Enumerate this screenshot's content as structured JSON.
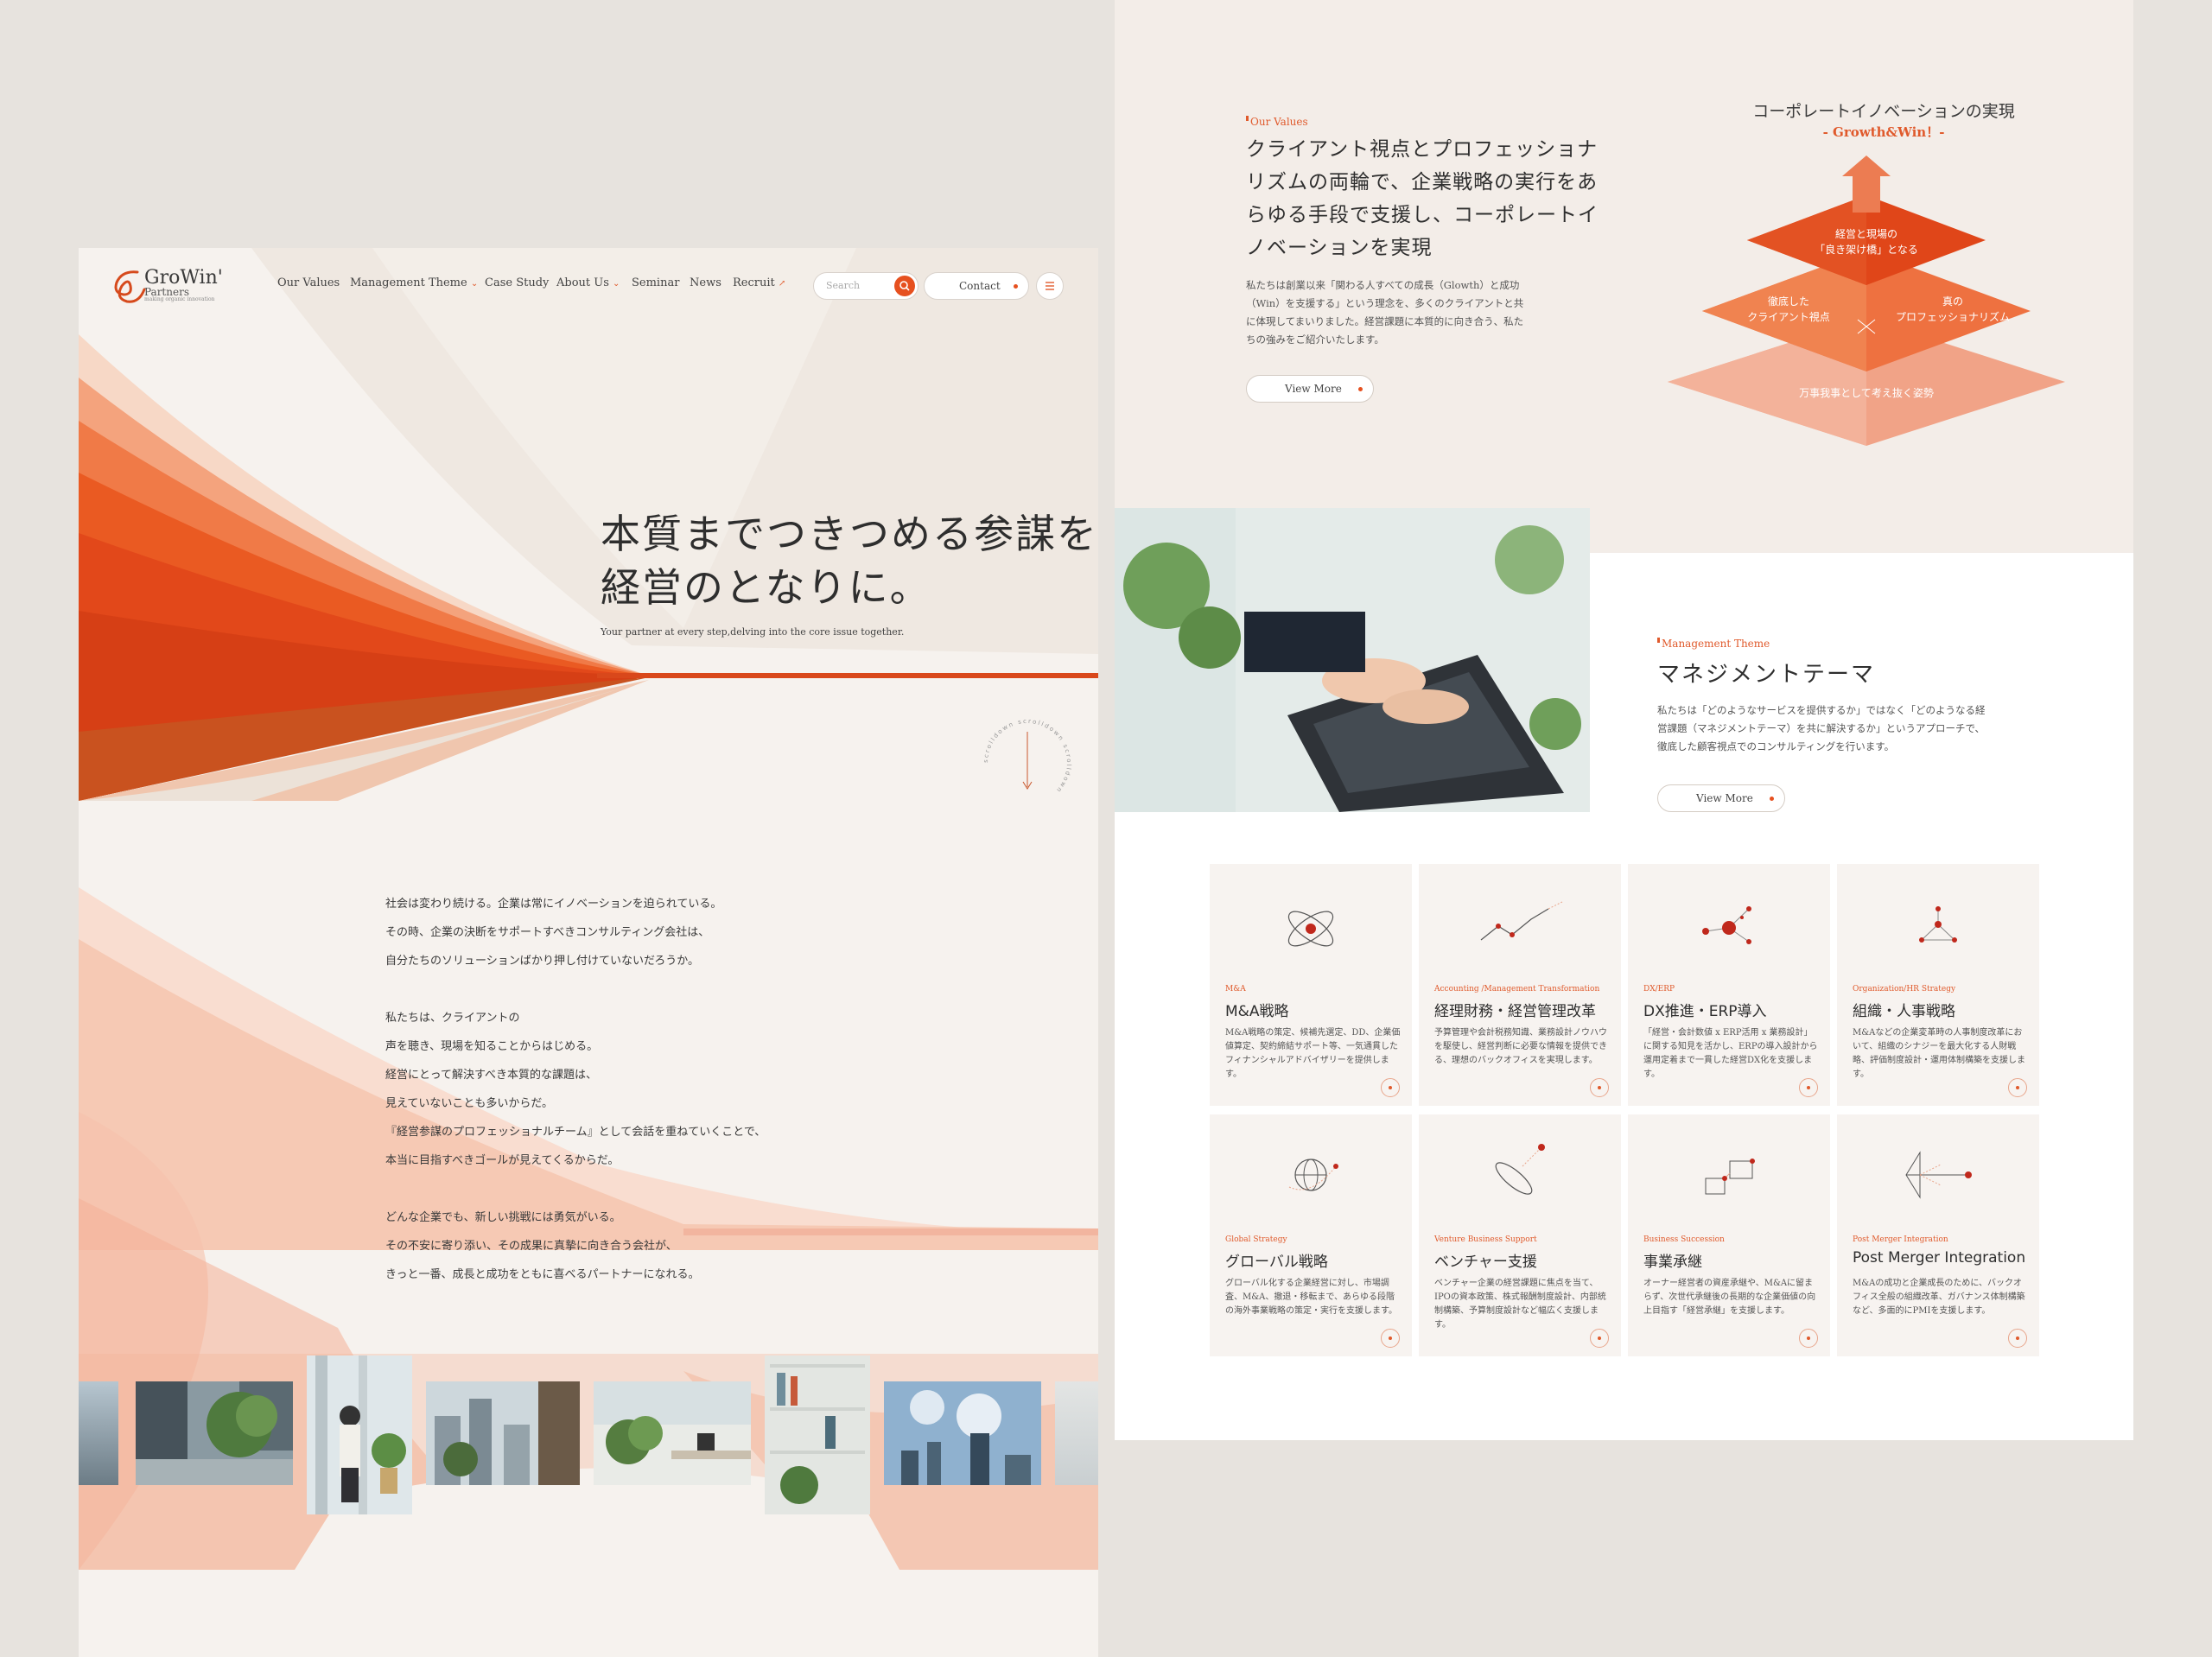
{
  "left_page": {
    "logo": {
      "name": "GroWin'",
      "sub": "Partners",
      "tagline": "making organic innovation"
    },
    "nav": {
      "items": [
        "Our Values",
        "Management Theme",
        "Case Study",
        "About Us",
        "Seminar",
        "News",
        "Recruit"
      ],
      "search_placeholder": "Search",
      "contact_label": "Contact"
    },
    "hero": {
      "title_line1": "本質までつきつめる参謀を、",
      "title_line2": "経営のとなりに。",
      "subtitle": "Your partner at every step,delving into the core issue together.",
      "scroll_label": "scrolldown scrolldown scrolldown"
    },
    "intro": {
      "paragraphs": [
        [
          "社会は変わり続ける。企業は常にイノベーションを迫られている。",
          "その時、企業の決断をサポートすべきコンサルティング会社は、",
          "自分たちのソリューションばかり押し付けていないだろうか。"
        ],
        [
          "私たちは、クライアントの",
          "声を聴き、現場を知ることからはじめる。",
          "経営にとって解決すべき本質的な課題は、",
          "見えていないことも多いからだ。",
          "『経営参謀のプロフェッショナルチーム』として会話を重ねていくことで、",
          "本当に目指すべきゴールが見えてくるからだ。"
        ],
        [
          "どんな企業でも、新しい挑戦には勇気がいる。",
          "その不安に寄り添い、その成果に真摯に向き合う会社が、",
          "きっと一番、成長と成功をともに喜べるパートナーになれる。"
        ]
      ]
    }
  },
  "right_page": {
    "values": {
      "eyebrow": "Our Values",
      "title": "クライアント視点とプロフェッショナリズムの両輪で、企業戦略の実行をあらゆる手段で支援し、コーポレートイノベーションを実現",
      "body": "私たちは創業以来「関わる人すべての成長（Glowth）と成功（Win）を支援する」という理念を、多くのクライアントと共に体現してまいりました。経営課題に本質的に向き合う、私たちの強みをご紹介いたします。",
      "button": "View More"
    },
    "pyramid": {
      "title": "コーポレートイノベーションの実現",
      "subtitle": "- Growth&Win！-",
      "top": "経営と現場の\n「良き架け橋」となる",
      "middle_left": "徹底した\nクライアント視点",
      "middle_right": "真の\nプロフェッショナリズム",
      "bottom": "万事我事として考え抜く姿勢"
    },
    "management": {
      "eyebrow": "Management Theme",
      "title": "マネジメントテーマ",
      "body": "私たちは「どのようなサービスを提供するか」ではなく「どのようなる経営課題（マネジメントテーマ）を共に解決するか」というアプローチで、徹底した顧客視点でのコンサルティングを行います。",
      "button": "View More"
    },
    "cards": [
      {
        "eyebrow": "M&A",
        "title": "M&A戦略",
        "body": "M&A戦略の策定、候補先選定、DD、企業価値算定、契約締結サポート等、一気通貫したフィナンシャルアドバイザリーを提供します。",
        "icon": "atom-icon"
      },
      {
        "eyebrow": "Accounting /Management Transformation",
        "title": "経理財務・経営管理改革",
        "body": "予算管理や会計税務知識、業務設計ノウハウを駆使し、経営判断に必要な情報を提供できる、理想のバックオフィスを実現します。",
        "icon": "trend-line-icon"
      },
      {
        "eyebrow": "DX/ERP",
        "title": "DX推進・ERP導入",
        "body": "「経営・会計数値 x ERP活用 x 業務設計」に関する知見を活かし、ERPの導入設計から運用定着まで一貫した経営DX化を支援します。",
        "icon": "network-icon"
      },
      {
        "eyebrow": "Organization/HR Strategy",
        "title": "組織・人事戦略",
        "body": "M&Aなどの企業変革時の人事制度改革において、組織のシナジーを最大化する人財戦略、評価制度設計・運用体制構築を支援します。",
        "icon": "org-chart-icon"
      },
      {
        "eyebrow": "Global Strategy",
        "title": "グローバル戦略",
        "body": "グローバル化する企業経営に対し、市場調査、M&A、撤退・移転まで、あらゆる段階の海外事業戦略の策定・実行を支援します。",
        "icon": "globe-icon"
      },
      {
        "eyebrow": "Venture Business Support",
        "title": "ベンチャー支援",
        "body": "ベンチャー企業の経営課題に焦点を当て、IPOの資本政策、株式報酬制度設計、内部統制構築、予算制度設計など幅広く支援します。",
        "icon": "rocket-icon"
      },
      {
        "eyebrow": "Business Succession",
        "title": "事業承継",
        "body": "オーナー経営者の資産承継や、M&Aに留まらず、次世代承継後の長期的な企業価値の向上目指す「経営承継」を支援します。",
        "icon": "succession-icon"
      },
      {
        "eyebrow": "Post Merger Integration",
        "title": "Post Merger Integration",
        "body": "M&Aの成功と企業成長のために、バックオフィス全般の組織改革、ガバナンス体制構築など、多面的にPMIを支援します。",
        "icon": "merge-arrow-icon"
      }
    ]
  },
  "colors": {
    "accent": "#e6501f",
    "bg": "#e7e3de",
    "panel": "#f6f2ee"
  }
}
